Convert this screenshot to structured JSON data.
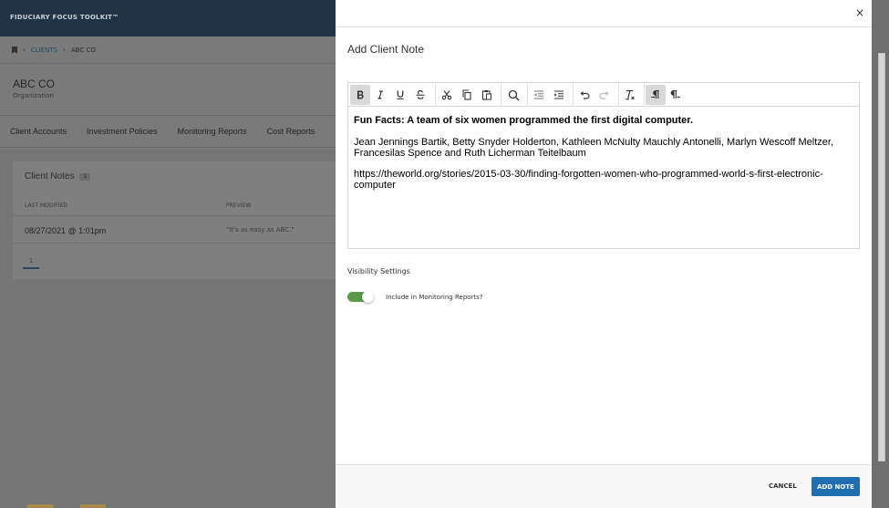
{
  "app": {
    "brand": "FIDUCIARY FOCUS TOOLKIT™"
  },
  "breadcrumb": {
    "clients": "CLIENTS",
    "current": "ABC CO"
  },
  "organization": {
    "name": "ABC CO",
    "type": "Organization"
  },
  "tabs": [
    {
      "label": "Client Accounts"
    },
    {
      "label": "Investment Policies"
    },
    {
      "label": "Monitoring Reports"
    },
    {
      "label": "Cost Reports"
    }
  ],
  "notes_card": {
    "title": "Client Notes",
    "count": "1",
    "columns": {
      "last_modified": "LAST MODIFIED",
      "preview": "PREVIEW"
    },
    "rows": [
      {
        "last_modified": "08/27/2021 @ 1:01pm",
        "preview": "\"It's as easy as ABC.\""
      }
    ],
    "page": "1"
  },
  "modal": {
    "title": "Add Client Note",
    "close": "×",
    "editor": {
      "toolbar": [
        "bold-icon",
        "italic-icon",
        "underline-icon",
        "strikethrough-icon",
        "cut-icon",
        "copy-icon",
        "paste-icon",
        "search-icon",
        "outdent-icon",
        "indent-icon",
        "undo-icon",
        "redo-icon",
        "clear-formatting-icon",
        "ltr-icon",
        "rtl-icon"
      ],
      "content": {
        "heading": "Fun Facts: A team of six women programmed the first digital computer.",
        "names": "Jean Jennings Bartik, Betty Snyder Holderton, Kathleen McNulty Mauchly Antonelli, Marlyn Wescoff Meltzer, Francesilas Spence and Ruth Licherman Teitelbaum",
        "link": "https://theworld.org/stories/2015-03-30/finding-forgotten-women-who-programmed-world-s-first-electronic-computer"
      }
    },
    "visibility": {
      "label": "Visibility Settings",
      "toggle_label": "Include in Monitoring Reports?",
      "toggle_on": true,
      "toggle_color": "#5a9a4a"
    },
    "footer": {
      "cancel": "CANCEL",
      "add": "ADD NOTE",
      "add_color": "#1f6fb0"
    }
  }
}
